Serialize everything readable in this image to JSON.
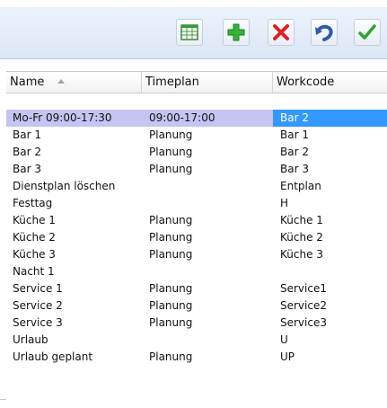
{
  "toolbar": {
    "buttons": [
      {
        "name": "table-view",
        "icon": "table-icon",
        "color": "#3a9a3a"
      },
      {
        "name": "add",
        "icon": "plus-icon",
        "color": "#27a327"
      },
      {
        "name": "delete",
        "icon": "x-icon",
        "color": "#e02020"
      },
      {
        "name": "undo",
        "icon": "undo-icon",
        "color": "#2e5aa8"
      },
      {
        "name": "confirm",
        "icon": "check-icon",
        "color": "#2aa52a"
      }
    ]
  },
  "grid": {
    "columns": {
      "name": "Name",
      "timeplan": "Timeplan",
      "workcode": "Workcode"
    },
    "rows": [
      {
        "name": "Mo-Fr 09:00-17:30",
        "timeplan": "09:00-17:00",
        "workcode": "Bar 2",
        "selected": true
      },
      {
        "name": "Bar 1",
        "timeplan": "Planung",
        "workcode": "Bar 1"
      },
      {
        "name": "Bar 2",
        "timeplan": "Planung",
        "workcode": "Bar 2"
      },
      {
        "name": "Bar 3",
        "timeplan": "Planung",
        "workcode": "Bar 3"
      },
      {
        "name": "Dienstplan löschen",
        "timeplan": "",
        "workcode": "Entplan"
      },
      {
        "name": "Festtag",
        "timeplan": "",
        "workcode": "H"
      },
      {
        "name": "Küche 1",
        "timeplan": "Planung",
        "workcode": "Küche 1"
      },
      {
        "name": "Küche 2",
        "timeplan": "Planung",
        "workcode": "Küche 2"
      },
      {
        "name": "Küche 3",
        "timeplan": "Planung",
        "workcode": "Küche 3"
      },
      {
        "name": "Nacht 1",
        "timeplan": "",
        "workcode": ""
      },
      {
        "name": "Service 1",
        "timeplan": "Planung",
        "workcode": "Service1"
      },
      {
        "name": "Service 2",
        "timeplan": "Planung",
        "workcode": "Service2"
      },
      {
        "name": "Service 3",
        "timeplan": "Planung",
        "workcode": "Service3"
      },
      {
        "name": "Urlaub",
        "timeplan": "",
        "workcode": "U"
      },
      {
        "name": "Urlaub geplant",
        "timeplan": "Planung",
        "workcode": "UP"
      }
    ]
  },
  "colors": {
    "selected_row": "#c6c4f2",
    "selected_cell": "#3399ff"
  }
}
